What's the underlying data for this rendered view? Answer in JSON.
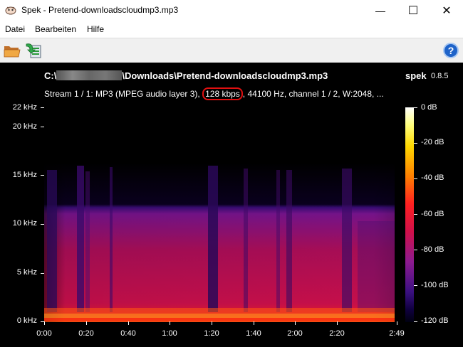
{
  "window": {
    "title": "Spek - Pretend-downloadscloudmp3.mp3",
    "minimize_glyph": "—",
    "maximize_glyph": "☐",
    "close_glyph": "✕"
  },
  "menu": {
    "items": [
      "Datei",
      "Bearbeiten",
      "Hilfe"
    ]
  },
  "toolbar": {
    "open_icon": "folder-open-icon",
    "save_icon": "save-image-icon",
    "help_label": "?"
  },
  "header": {
    "path_prefix": "C:\\",
    "path_suffix": "\\Downloads\\Pretend-downloadscloudmp3.mp3",
    "app_name": "spek",
    "version": "0.8.5",
    "stream_before": "Stream 1 / 1: MP3 (MPEG audio layer 3), ",
    "bitrate": "128 kbps",
    "stream_after": ", 44100 Hz, channel 1 / 2, W:2048, ..."
  },
  "colors": {
    "highlight": "#e01010",
    "background": "#000000"
  },
  "chart_data": {
    "type": "heatmap",
    "y_axis": {
      "unit": "kHz",
      "ticks": [
        "22 kHz",
        "20 kHz",
        "15 kHz",
        "10 kHz",
        "5 kHz",
        "0 kHz"
      ],
      "range": [
        0,
        22
      ]
    },
    "x_axis": {
      "unit": "mm:ss",
      "ticks": [
        "0:00",
        "0:20",
        "0:40",
        "1:00",
        "1:20",
        "1:40",
        "2:00",
        "2:20",
        "2:49"
      ],
      "range_seconds": [
        0,
        169
      ]
    },
    "colorbar": {
      "ticks": [
        "0 dB",
        "-20 dB",
        "-40 dB",
        "-60 dB",
        "-80 dB",
        "-100 dB",
        "-120 dB"
      ],
      "range_db": [
        -120,
        0
      ]
    },
    "lowpass_cutoff_khz": 16
  }
}
